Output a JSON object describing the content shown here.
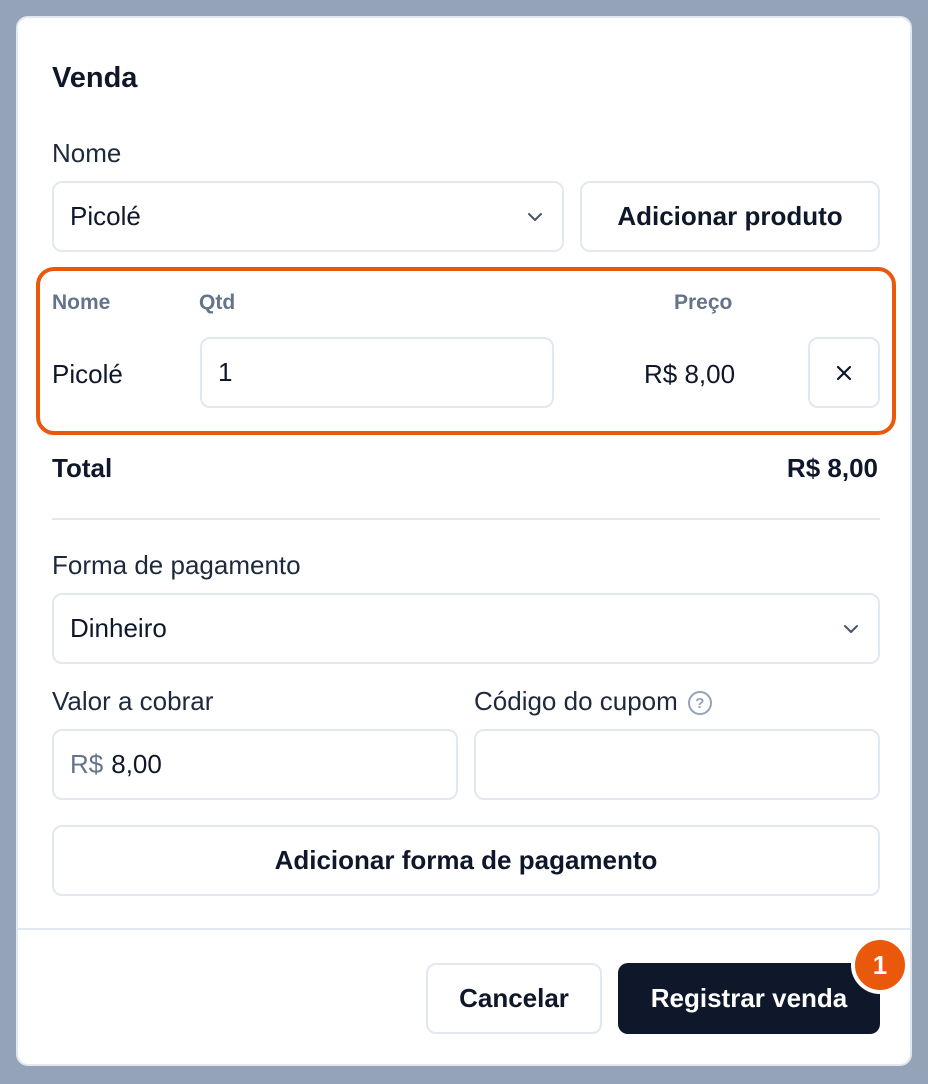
{
  "dialog": {
    "title": "Venda"
  },
  "product": {
    "label": "Nome",
    "selected": "Picolé",
    "add_button": "Adicionar produto"
  },
  "items_table": {
    "headers": {
      "name": "Nome",
      "qty": "Qtd",
      "price": "Preço"
    },
    "rows": [
      {
        "name": "Picolé",
        "qty": "1",
        "price": "R$ 8,00"
      }
    ]
  },
  "total": {
    "label": "Total",
    "value": "R$ 8,00"
  },
  "payment": {
    "method_label": "Forma de pagamento",
    "method_selected": "Dinheiro",
    "amount_label": "Valor a cobrar",
    "amount_prefix": "R$",
    "amount_value": "8,00",
    "coupon_label": "Código do cupom",
    "coupon_value": "",
    "add_payment_button": "Adicionar forma de pagamento"
  },
  "footer": {
    "cancel_button": "Cancelar",
    "submit_button": "Registrar venda",
    "step_badge": "1"
  },
  "colors": {
    "highlight": "#ea580c",
    "primary": "#0f172a",
    "backdrop": "#94a3b8"
  },
  "icons": {
    "select_chevron": "chevron-down-icon",
    "remove": "close-icon",
    "help": "help-circle-icon"
  }
}
